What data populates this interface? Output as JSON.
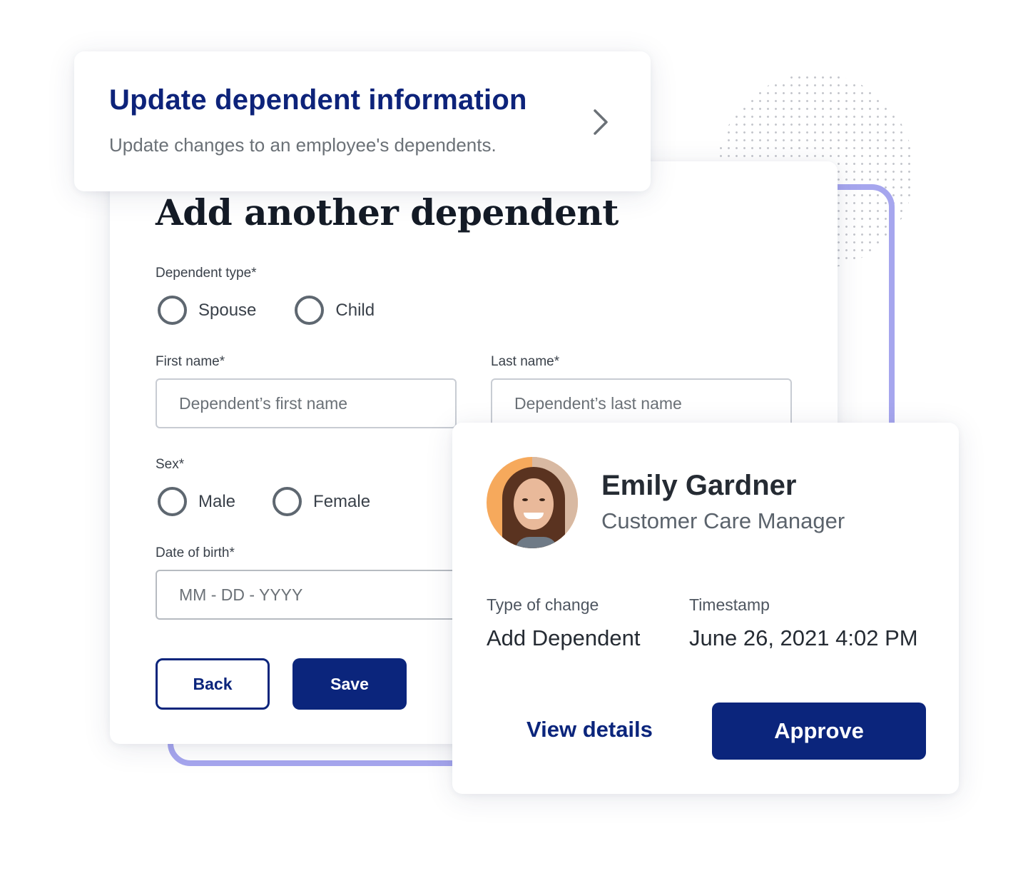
{
  "update_card": {
    "title": "Update dependent information",
    "subtitle": "Update changes to an employee's dependents.",
    "chevron_icon": "chevron-right"
  },
  "form": {
    "title": "Add another dependent",
    "dependent_type": {
      "label": "Dependent type*",
      "options": [
        {
          "label": "Spouse",
          "selected": false
        },
        {
          "label": "Child",
          "selected": false
        }
      ]
    },
    "first_name": {
      "label": "First name*",
      "placeholder": "Dependent’s first name",
      "value": ""
    },
    "last_name": {
      "label": "Last name*",
      "placeholder": "Dependent’s last name",
      "value": ""
    },
    "sex": {
      "label": "Sex*",
      "options": [
        {
          "label": "Male",
          "selected": false
        },
        {
          "label": "Female",
          "selected": false
        }
      ]
    },
    "dob": {
      "label": "Date of birth*",
      "placeholder": "MM - DD - YYYY",
      "value": ""
    },
    "buttons": {
      "back": "Back",
      "save": "Save"
    }
  },
  "approval_card": {
    "person": {
      "name": "Emily Gardner",
      "role": "Customer Care Manager",
      "avatar": "portrait-photo"
    },
    "type_of_change": {
      "label": "Type of change",
      "value": "Add Dependent"
    },
    "timestamp": {
      "label": "Timestamp",
      "value": "June 26, 2021 4:02 PM"
    },
    "buttons": {
      "view_details": "View details",
      "approve": "Approve"
    }
  },
  "colors": {
    "brand_navy": "#0b257c",
    "accent_lavender": "#a6a6ee",
    "text_dark": "#252b33",
    "text_muted": "#6b7177"
  }
}
